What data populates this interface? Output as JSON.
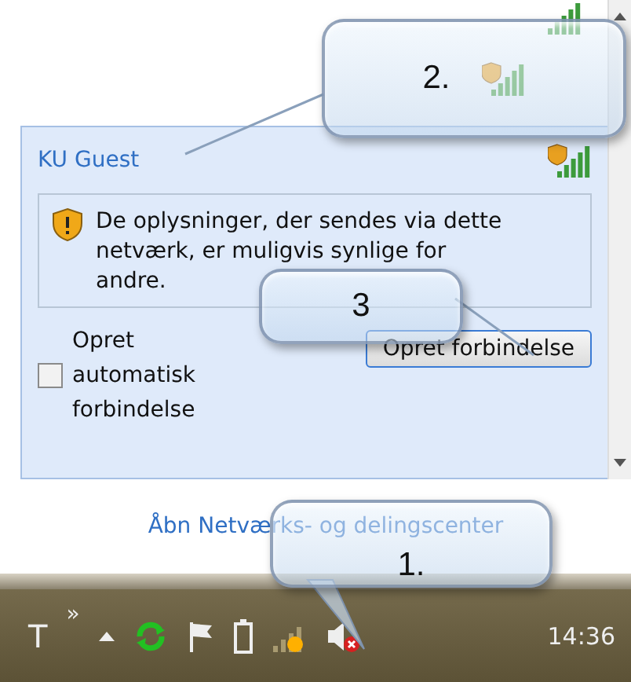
{
  "flyout": {
    "network": {
      "name": "KU Guest"
    },
    "warning": "De oplysninger, der sendes via dette netværk, er muligvis synlige for andre.",
    "auto_connect": {
      "label": "Opret automatisk forbindelse",
      "checked": false
    },
    "connect_button": "Opret forbindelse"
  },
  "footer_link": "Åbn Netværks- og delingscenter",
  "taskbar": {
    "toolbar_label": "T",
    "overflow": "»",
    "clock": "14:36"
  },
  "callouts": [
    {
      "label": "2."
    },
    {
      "label": "3"
    },
    {
      "label": "1."
    }
  ]
}
